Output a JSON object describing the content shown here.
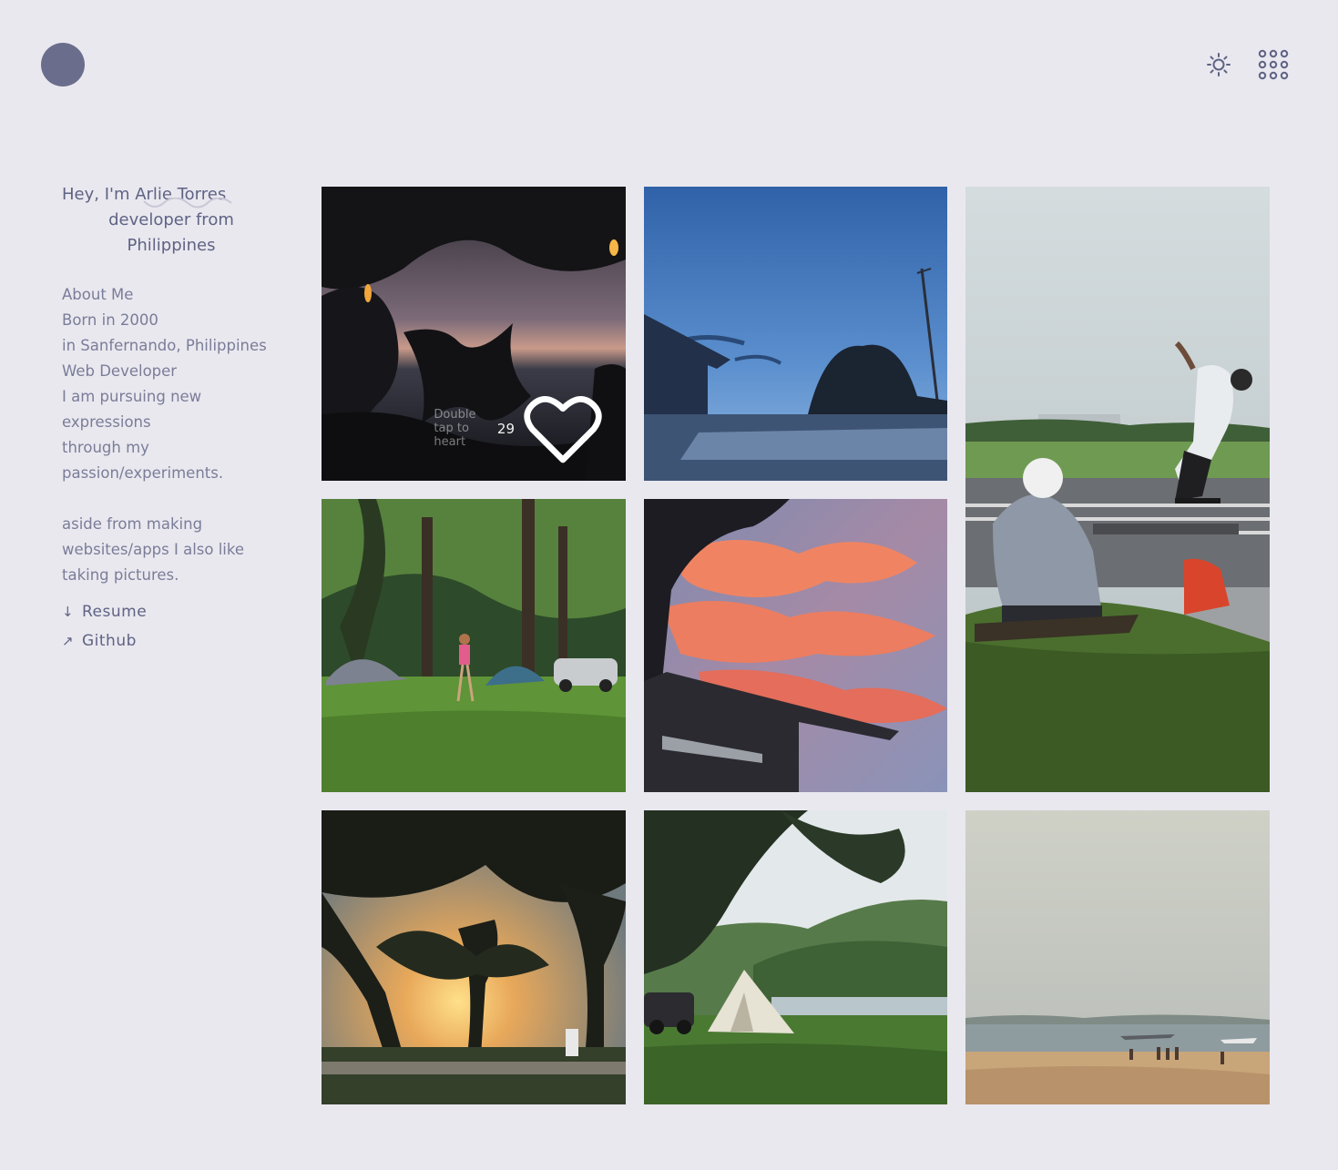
{
  "header": {
    "avatar_icon": "avatar-circle",
    "theme_icon": "sun-icon",
    "menu_icon": "grid-dots-icon"
  },
  "intro": {
    "greeting_prefix": "Hey, I'm ",
    "name": "Arlie Torres",
    "greeting_line2": "developer from",
    "greeting_line3": "Philippines"
  },
  "about": {
    "lines": [
      "About Me",
      "Born in 2000",
      "in Sanfernando, Philippines",
      "Web Developer",
      "I am pursuing new",
      "expressions",
      "through my",
      "passion/experiments."
    ],
    "lines2": [
      "aside from making",
      "websites/apps I also like",
      "taking pictures."
    ]
  },
  "links": {
    "resume": {
      "arrow": "↓",
      "label": "Resume"
    },
    "github": {
      "arrow": "↗",
      "label": "Github"
    }
  },
  "photos": {
    "first": {
      "hint": "Double tap to heart",
      "likes": "29",
      "like_icon": "heart-icon"
    }
  },
  "colors": {
    "background": "#e9e8ef",
    "accent": "#6a6e8c"
  }
}
